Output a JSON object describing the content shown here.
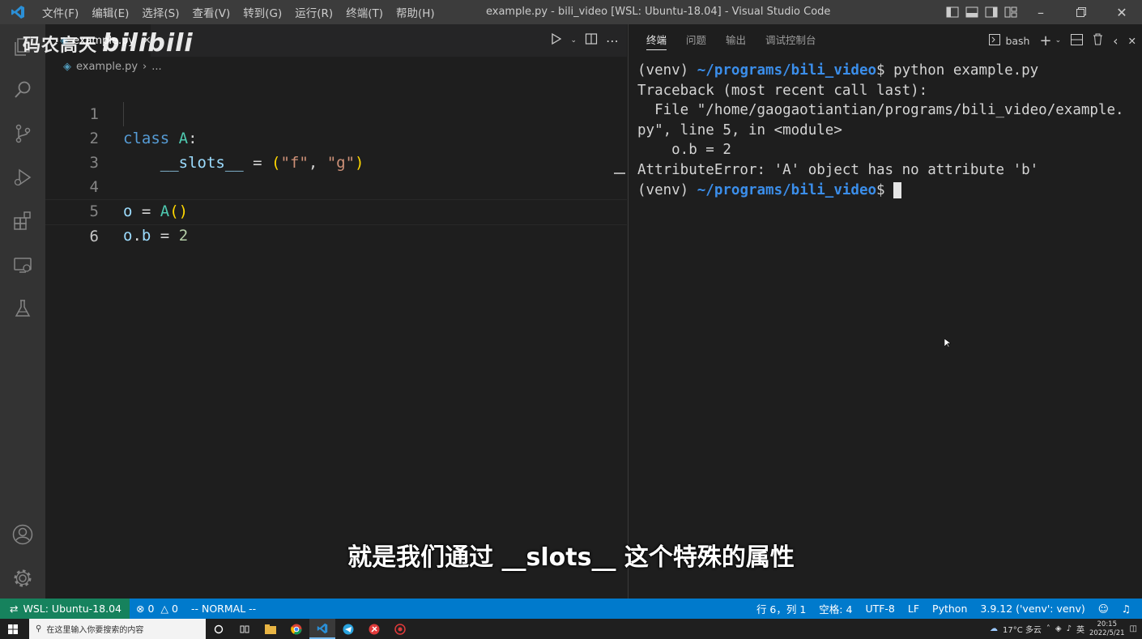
{
  "titlebar": {
    "menu": [
      "文件(F)",
      "编辑(E)",
      "选择(S)",
      "查看(V)",
      "转到(G)",
      "运行(R)",
      "终端(T)",
      "帮助(H)"
    ],
    "title": "example.py - bili_video [WSL: Ubuntu-18.04] - Visual Studio Code"
  },
  "watermark": {
    "text": "码农高天",
    "brand": "bilibili"
  },
  "editor": {
    "tab_label": "example.py",
    "breadcrumb_file": "example.py",
    "breadcrumb_rest": "...",
    "lines": [
      {
        "num": "1"
      },
      {
        "num": "2"
      },
      {
        "num": "3"
      },
      {
        "num": "4"
      },
      {
        "num": "5"
      },
      {
        "num": "6"
      }
    ],
    "code": {
      "l1_kw": "class",
      "l1_name": "A",
      "l1_colon": ":",
      "l2_indent": "    ",
      "l2_var": "__slots__",
      "l2_eq": " = ",
      "l2_open": "(",
      "l2_s1": "\"f\"",
      "l2_comma": ", ",
      "l2_s2": "\"g\"",
      "l2_close": ")",
      "l4_var": "o",
      "l4_eq": " = ",
      "l4_call": "A",
      "l4_paren": "()",
      "l5_var": "o",
      "l5_dot": ".",
      "l5_attr": "b",
      "l5_eq": " = ",
      "l5_num": "2"
    }
  },
  "panel": {
    "tabs": [
      "终端",
      "问题",
      "输出",
      "调试控制台"
    ],
    "shell": "bash",
    "terminal": {
      "l1_env": "(venv) ",
      "l1_path": "~/programs/bili_video",
      "l1_cmd": "$ python example.py",
      "l2": "Traceback (most recent call last):",
      "l3": "  File \"/home/gaogaotiantian/programs/bili_video/example.",
      "l4": "py\", line 5, in <module>",
      "l5": "    o.b = 2",
      "l6": "AttributeError: 'A' object has no attribute 'b'",
      "l7_env": "(venv) ",
      "l7_path": "~/programs/bili_video",
      "l7_prompt": "$ "
    }
  },
  "subtitle": "就是我们通过 __slots__ 这个特殊的属性",
  "statusbar": {
    "remote": "WSL: Ubuntu-18.04",
    "errors": "0",
    "warnings": "0",
    "mode": "-- NORMAL --",
    "position": "行 6，列 1",
    "spaces": "空格: 4",
    "encoding": "UTF-8",
    "eol": "LF",
    "language": "Python",
    "interpreter": "3.9.12 ('venv': venv)"
  },
  "taskbar": {
    "search_placeholder": "在这里输入你要搜索的内容",
    "weather": "17°C 多云",
    "ime": "英",
    "time": "20:15",
    "date": "2022/5/21"
  },
  "colors": {
    "statusbar": "#007acc",
    "remote": "#16825d",
    "keyword": "#569cd6",
    "class": "#4ec9b0",
    "string": "#ce9178",
    "terminal_path": "#3b8eea"
  }
}
